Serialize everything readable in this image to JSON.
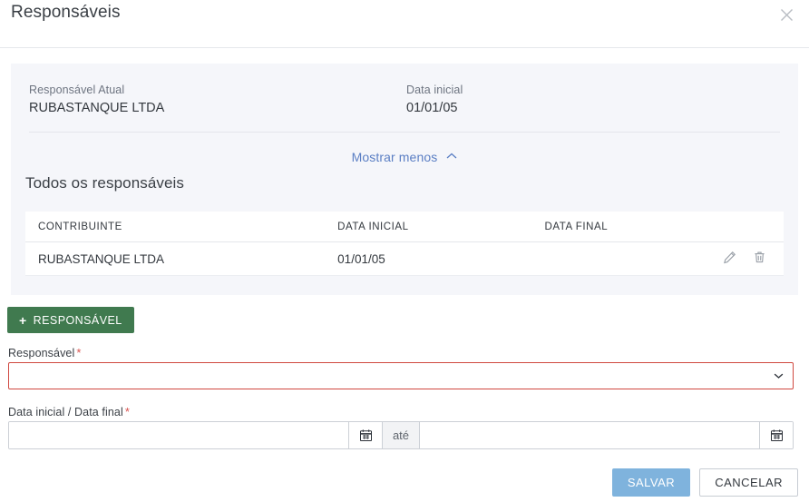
{
  "modal": {
    "title": "Responsáveis",
    "close_icon": "close-icon"
  },
  "summary": {
    "fields": [
      {
        "label": "Responsável Atual",
        "value": "RUBASTANQUE LTDA"
      },
      {
        "label": "Data inicial",
        "value": "01/01/05"
      }
    ],
    "toggle_label": "Mostrar menos",
    "toggle_icon": "chevron-up-icon",
    "section_heading": "Todos os responsáveis"
  },
  "table": {
    "columns": [
      "CONTRIBUINTE",
      "DATA INICIAL",
      "DATA FINAL",
      ""
    ],
    "rows": [
      {
        "contribuinte": "RUBASTANQUE LTDA",
        "data_inicial": "01/01/05",
        "data_final": "",
        "edit_icon": "pencil-icon",
        "delete_icon": "trash-icon"
      }
    ]
  },
  "form": {
    "add_button": {
      "plus": "+",
      "label": "RESPONSÁVEL"
    },
    "responsavel": {
      "label": "Responsável",
      "required_marker": "*",
      "value": "",
      "placeholder": "",
      "chevron_icon": "chevron-down-icon"
    },
    "periodo": {
      "label": "Data inicial / Data final",
      "required_marker": "*",
      "start_value": "",
      "start_placeholder": "",
      "end_value": "",
      "end_placeholder": "",
      "separator_label": "até",
      "calendar_icon": "calendar-icon"
    }
  },
  "footer": {
    "save_label": "SALVAR",
    "cancel_label": "CANCELAR"
  },
  "colors": {
    "accent_green": "#407a4f",
    "link_blue": "#5b7fc4",
    "save_blue": "#7fb3dd",
    "error_red": "#d0483f",
    "panel_bg": "#f5f6fa"
  }
}
